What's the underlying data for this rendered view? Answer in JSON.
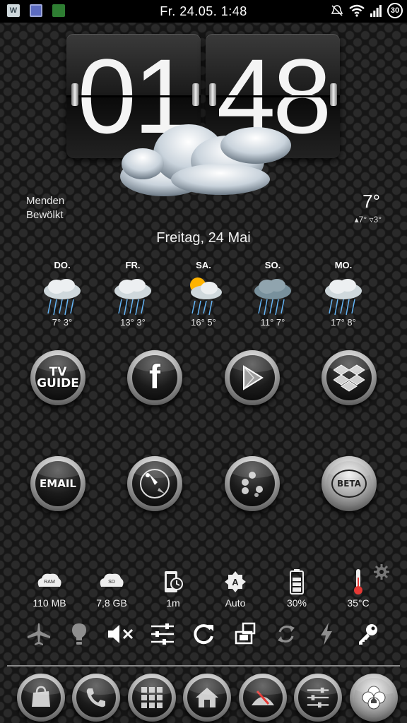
{
  "status_bar": {
    "notif_w_label": "W",
    "datetime": "Fr. 24.05.  1:48",
    "battery_badge": "30"
  },
  "clock": {
    "hours": "01",
    "minutes": "48"
  },
  "weather": {
    "location": "Menden",
    "condition": "Bewölkt",
    "temp_now": "7°",
    "high": "7°",
    "low": "3°",
    "date": "Freitag, 24 Mai"
  },
  "forecast": [
    {
      "day": "DO.",
      "temps": "7° 3°",
      "icon": "rain-cloud-icon"
    },
    {
      "day": "FR.",
      "temps": "13° 3°",
      "icon": "rain-cloud-icon"
    },
    {
      "day": "SA.",
      "temps": "16° 5°",
      "icon": "sun-rain-cloud-icon"
    },
    {
      "day": "SO.",
      "temps": "11° 7°",
      "icon": "dark-rain-cloud-icon"
    },
    {
      "day": "MO.",
      "temps": "17° 8°",
      "icon": "rain-cloud-icon"
    }
  ],
  "apps_row1": [
    {
      "label": "TV\nGUIDE",
      "icon": "tv-guide-icon"
    },
    {
      "label": "f",
      "icon": "facebook-icon"
    },
    {
      "label": "",
      "icon": "play-store-icon"
    },
    {
      "label": "",
      "icon": "dropbox-icon"
    }
  ],
  "apps_row2": [
    {
      "label": "EMAIL",
      "icon": "email-icon"
    },
    {
      "label": "",
      "icon": "compass-icon"
    },
    {
      "label": "",
      "icon": "game-icon"
    },
    {
      "label": "BETA",
      "icon": "beta-icon"
    }
  ],
  "system": [
    {
      "icon_text": "RAM",
      "value": "110 MB",
      "icon": "ram-icon"
    },
    {
      "icon_text": "SD",
      "value": "7,8 GB",
      "icon": "sd-card-icon"
    },
    {
      "icon_text": "",
      "value": "1m",
      "icon": "screen-timeout-icon"
    },
    {
      "icon_text": "A",
      "value": "Auto",
      "icon": "brightness-auto-icon"
    },
    {
      "icon_text": "",
      "value": "30%",
      "icon": "battery-icon"
    },
    {
      "icon_text": "",
      "value": "35°C",
      "icon": "thermometer-icon"
    }
  ],
  "toggles": [
    "airplane-icon",
    "bulb-icon",
    "mute-icon",
    "settings-sliders-icon",
    "refresh-icon",
    "rotate-icon",
    "sync-icon",
    "flash-icon",
    "key-icon"
  ],
  "dock": [
    "shopping-bag-icon",
    "phone-icon",
    "app-drawer-icon",
    "home-icon",
    "compass-icon",
    "settings-sliders-icon",
    "clover-icon"
  ],
  "colors": {
    "background": "#161616",
    "hex_pattern": "#2a2a2a",
    "text": "#ffffff",
    "status_bar": "#000000"
  }
}
